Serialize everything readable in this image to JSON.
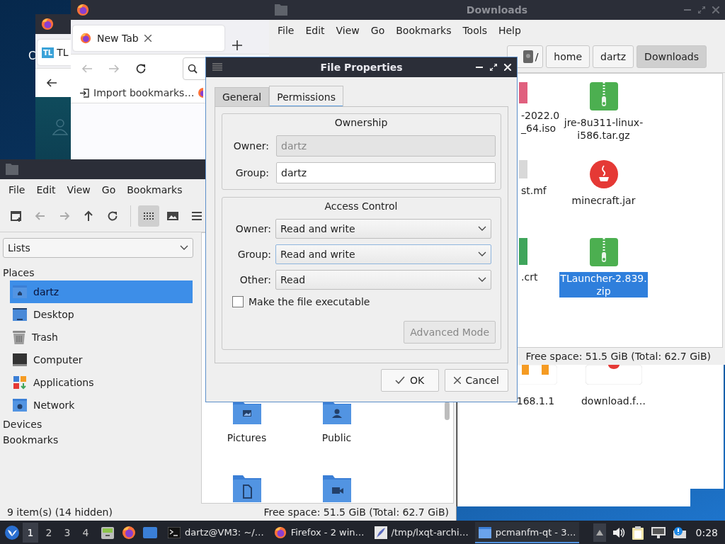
{
  "desktop": {
    "label": "C"
  },
  "firefox_back": {
    "tab": {
      "badge": "TL",
      "label": "TL",
      "selected": true
    },
    "nav": [
      {
        "kind": "back",
        "disabled": false
      }
    ]
  },
  "firefox": {
    "tab": {
      "label": "New Tab",
      "selected": true
    },
    "nav": [
      {
        "kind": "back",
        "disabled": true
      },
      {
        "kind": "forward",
        "disabled": true
      },
      {
        "kind": "reload",
        "disabled": false
      }
    ],
    "bookmarks": [
      {
        "label": "Import bookmarks…"
      }
    ]
  },
  "downloads_window": {
    "title": "Downloads",
    "menu": [
      "File",
      "Edit",
      "View",
      "Go",
      "Bookmarks",
      "Tools",
      "Help"
    ],
    "path": [
      {
        "label": "/",
        "selected": false
      },
      {
        "label": "home",
        "selected": false
      },
      {
        "label": "dartz",
        "selected": false
      },
      {
        "label": "Downloads",
        "selected": true
      }
    ],
    "columns": [
      {
        "files": [
          {
            "kind": "disc",
            "lines": [
              "-2022.0",
              "_64.iso"
            ],
            "selected": false
          },
          {
            "kind": "text",
            "lines": [
              "st.mf"
            ],
            "selected": false
          },
          {
            "kind": "certificate",
            "lines": [
              ".crt"
            ],
            "selected": false
          }
        ]
      },
      {
        "files": [
          {
            "kind": "archive",
            "lines": [
              "jre-8u311-linux-",
              "i586.tar.gz"
            ],
            "selected": false
          },
          {
            "kind": "java",
            "lines": [
              "minecraft.jar"
            ],
            "selected": false
          },
          {
            "kind": "archive",
            "lines": [
              "TLauncher-2.839.",
              "zip"
            ],
            "selected": true
          }
        ]
      }
    ],
    "status": "Free space: 51.5 GiB (Total: 62.7 GiB)"
  },
  "back_window": {
    "files": [
      {
        "kind": "web",
        "label": "168.1.1"
      },
      {
        "kind": "document",
        "label": "download.f…"
      }
    ]
  },
  "file_manager": {
    "menu": [
      "File",
      "Edit",
      "View",
      "Go",
      "Bookmarks"
    ],
    "toolbar": [
      {
        "kind": "new-window",
        "disabled": false,
        "selected": false
      },
      {
        "kind": "back",
        "disabled": true,
        "selected": false
      },
      {
        "kind": "forward",
        "disabled": true,
        "selected": false
      },
      {
        "kind": "up",
        "disabled": false,
        "selected": false
      },
      {
        "kind": "reload",
        "disabled": false,
        "selected": false
      },
      {
        "kind": "icon-view",
        "disabled": false,
        "selected": true
      },
      {
        "kind": "thumbnail-view",
        "disabled": false,
        "selected": false
      },
      {
        "kind": "menu",
        "disabled": false,
        "selected": false
      }
    ],
    "side_pane": {
      "mode": "Lists",
      "sections": [
        {
          "title": "Places",
          "items": [
            {
              "label": "dartz",
              "kind": "home",
              "selected": true
            },
            {
              "label": "Desktop",
              "kind": "desktop",
              "selected": false
            },
            {
              "label": "Trash",
              "kind": "trash",
              "selected": false
            },
            {
              "label": "Computer",
              "kind": "computer",
              "selected": false
            },
            {
              "label": "Applications",
              "kind": "applications",
              "selected": false
            },
            {
              "label": "Network",
              "kind": "network",
              "selected": false
            }
          ]
        },
        {
          "title": "Devices"
        },
        {
          "title": "Bookmarks"
        }
      ]
    },
    "files": [
      {
        "kind": "pictures",
        "label": "Pictures"
      },
      {
        "kind": "public",
        "label": "Public"
      },
      {
        "kind": "documents"
      },
      {
        "kind": "videos"
      }
    ],
    "status_left": "9 item(s) (14 hidden)",
    "status_right": "Free space: 51.5 GiB (Total: 62.7 GiB)"
  },
  "dialog": {
    "title": "File Properties",
    "tabs": [
      {
        "label": "General",
        "selected": false
      },
      {
        "label": "Permissions",
        "selected": true
      }
    ],
    "ownership": {
      "title": "Ownership",
      "fields": [
        {
          "label": "Owner:",
          "value": "dartz",
          "disabled": true
        },
        {
          "label": "Group:",
          "value": "dartz",
          "disabled": false
        }
      ]
    },
    "access": {
      "title": "Access Control",
      "selects": [
        {
          "label": "Owner:",
          "value": "Read and write",
          "focused": false
        },
        {
          "label": "Group:",
          "value": "Read and write",
          "focused": true
        },
        {
          "label": "Other:",
          "value": "Read",
          "focused": false
        }
      ],
      "executable": {
        "label": "Make the file executable",
        "checked": false
      },
      "advanced": {
        "label": "Advanced Mode",
        "disabled": true
      }
    },
    "buttons": [
      {
        "kind": "ok",
        "label": "OK"
      },
      {
        "kind": "cancel",
        "label": "Cancel"
      }
    ]
  },
  "taskbar": {
    "workspaces": [
      {
        "label": "1",
        "selected": true
      },
      {
        "label": "2",
        "selected": false
      },
      {
        "label": "3",
        "selected": false
      },
      {
        "label": "4",
        "selected": false
      }
    ],
    "launchers": [
      {
        "kind": "files"
      },
      {
        "kind": "firefox"
      },
      {
        "kind": "desktop"
      }
    ],
    "tasks": [
      {
        "kind": "terminal",
        "label": "dartz@VM3: ~/…",
        "selected": false
      },
      {
        "kind": "firefox",
        "label": "Firefox - 2 win…",
        "selected": false
      },
      {
        "kind": "archiver",
        "label": "/tmp/lxqt-archi…",
        "selected": false
      },
      {
        "kind": "folder",
        "label": "pcmanfm-qt - 3…",
        "selected": true
      }
    ],
    "tray": [
      {
        "kind": "eject"
      },
      {
        "kind": "volume"
      },
      {
        "kind": "clipboard"
      },
      {
        "kind": "network"
      },
      {
        "kind": "updates"
      }
    ],
    "clock": "0:28"
  }
}
